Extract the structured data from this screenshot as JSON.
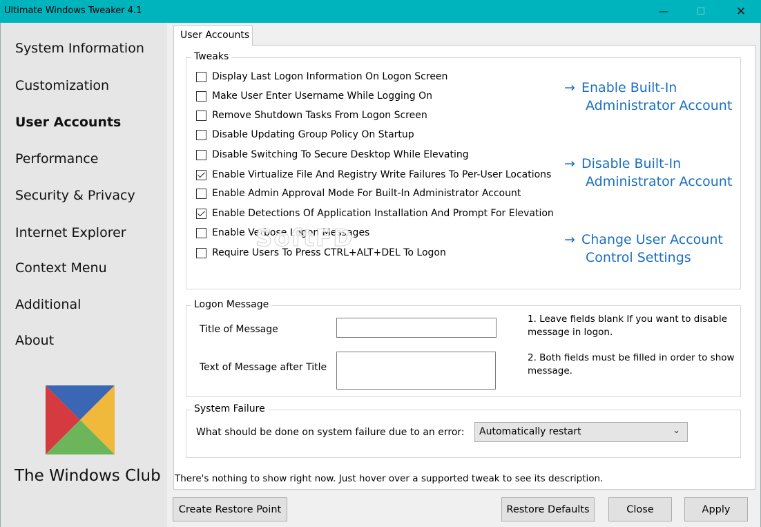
{
  "window": {
    "title": "Ultimate Windows Tweaker 4.1",
    "minimize": "—",
    "maximize": "☐",
    "close": "✕"
  },
  "sidebar": {
    "items": [
      {
        "label": "System Information"
      },
      {
        "label": "Customization"
      },
      {
        "label": "User Accounts",
        "active": true
      },
      {
        "label": "Performance"
      },
      {
        "label": "Security & Privacy"
      },
      {
        "label": "Internet Explorer"
      },
      {
        "label": "Context Menu"
      },
      {
        "label": "Additional"
      },
      {
        "label": "About"
      }
    ],
    "logo_text": "The Windows Club",
    "logo_colors": {
      "top": "#3a66b3",
      "left": "#d43a3f",
      "right": "#f0b93c",
      "bottom": "#6db55a"
    }
  },
  "tab": {
    "label": "User Accounts"
  },
  "tweaks": {
    "title": "Tweaks",
    "items": [
      {
        "label": "Display Last Logon Information On Logon Screen",
        "checked": false
      },
      {
        "label": "Make User Enter Username While Logging On",
        "checked": false
      },
      {
        "label": "Remove Shutdown Tasks From Logon Screen",
        "checked": false
      },
      {
        "label": "Disable Updating Group Policy On Startup",
        "checked": false
      },
      {
        "label": "Disable Switching To Secure Desktop While Elevating",
        "checked": false
      },
      {
        "label": "Enable Virtualize File And Registry Write Failures To Per-User Locations",
        "checked": true
      },
      {
        "label": "Enable Admin Approval Mode For Built-In Administrator Account",
        "checked": false
      },
      {
        "label": "Enable Detections Of Application Installation And Prompt For Elevation",
        "checked": true
      },
      {
        "label": "Enable Verbose Logon Messages",
        "checked": false
      },
      {
        "label": "Require Users To Press CTRL+ALT+DEL To Logon",
        "checked": false
      }
    ],
    "links": [
      {
        "arrow": "→",
        "line1": "Enable Built-In",
        "line2": "Administrator Account"
      },
      {
        "arrow": "→",
        "line1": "Disable Built-In",
        "line2": "Administrator Account"
      },
      {
        "arrow": "→",
        "line1": "Change User Account",
        "line2": "Control Settings"
      }
    ],
    "link_color": "#1a6fc0"
  },
  "logon_message": {
    "title": "Logon Message",
    "title_label": "Title of Message",
    "title_value": "",
    "text_label": "Text of Message after Title",
    "text_value": "",
    "note1": "1. Leave fields blank If you want to disable message in logon.",
    "note2": "2. Both fields must be filled in order to show message."
  },
  "system_failure": {
    "title": "System Failure",
    "question": "What should be done on system failure due to an error:",
    "selected": "Automatically restart"
  },
  "status": "There's nothing to show right now. Just hover over a supported tweak to see its description.",
  "buttons": {
    "restore_point": "Create Restore Point",
    "restore_defaults": "Restore Defaults",
    "close": "Close",
    "apply": "Apply"
  },
  "watermark": "SoftFD",
  "colors": {
    "titlebar": "#00b4be",
    "sidebar": "#e6e6e6"
  }
}
